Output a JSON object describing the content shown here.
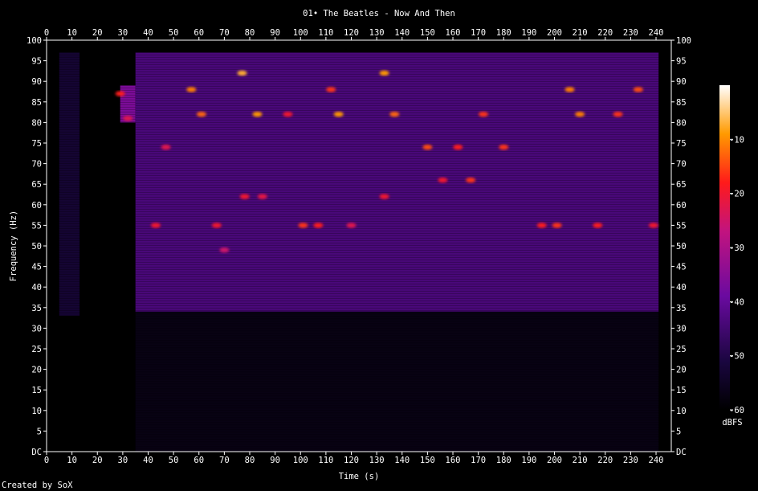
{
  "chart_data": {
    "type": "heatmap",
    "subtype": "spectrogram",
    "title": "01• The Beatles - Now And Then",
    "xlabel": "Time (s)",
    "ylabel": "Frequency (Hz)",
    "xlim": [
      0,
      246
    ],
    "ylim": [
      0,
      100
    ],
    "x_ticks": [
      0,
      10,
      20,
      30,
      40,
      50,
      60,
      70,
      80,
      90,
      100,
      110,
      120,
      130,
      140,
      150,
      160,
      170,
      180,
      190,
      200,
      210,
      220,
      230,
      240
    ],
    "y_ticks": [
      {
        "v": 0,
        "label": "DC"
      },
      {
        "v": 5,
        "label": "5"
      },
      {
        "v": 10,
        "label": "10"
      },
      {
        "v": 15,
        "label": "15"
      },
      {
        "v": 20,
        "label": "20"
      },
      {
        "v": 25,
        "label": "25"
      },
      {
        "v": 30,
        "label": "30"
      },
      {
        "v": 35,
        "label": "35"
      },
      {
        "v": 40,
        "label": "40"
      },
      {
        "v": 45,
        "label": "45"
      },
      {
        "v": 50,
        "label": "50"
      },
      {
        "v": 55,
        "label": "55"
      },
      {
        "v": 60,
        "label": "60"
      },
      {
        "v": 65,
        "label": "65"
      },
      {
        "v": 70,
        "label": "70"
      },
      {
        "v": 75,
        "label": "75"
      },
      {
        "v": 80,
        "label": "80"
      },
      {
        "v": 85,
        "label": "85"
      },
      {
        "v": 90,
        "label": "90"
      },
      {
        "v": 95,
        "label": "95"
      },
      {
        "v": 100,
        "label": "100"
      }
    ],
    "colorbar": {
      "unit": "dBFS",
      "range": [
        -60,
        0
      ],
      "ticks": [
        -10,
        -20,
        -30,
        -40,
        -50,
        -60
      ]
    },
    "bands": [
      {
        "t0": 5,
        "t1": 13,
        "f0": 33,
        "f1": 97,
        "level": -52
      },
      {
        "t0": 29,
        "t1": 35,
        "f0": 80,
        "f1": 89,
        "level": -38
      },
      {
        "t0": 35,
        "t1": 241,
        "f0": 34,
        "f1": 97,
        "level": -44
      },
      {
        "t0": 35,
        "t1": 241,
        "f0": 0,
        "f1": 34,
        "level": -57
      }
    ],
    "hotspots": [
      {
        "t": 29,
        "f": 87,
        "level": -20
      },
      {
        "t": 32,
        "f": 81,
        "level": -25
      },
      {
        "t": 47,
        "f": 74,
        "level": -25
      },
      {
        "t": 43,
        "f": 55,
        "level": -22
      },
      {
        "t": 57,
        "f": 88,
        "level": -12
      },
      {
        "t": 61,
        "f": 82,
        "level": -14
      },
      {
        "t": 67,
        "f": 55,
        "level": -22
      },
      {
        "t": 70,
        "f": 49,
        "level": -28
      },
      {
        "t": 77,
        "f": 92,
        "level": -8
      },
      {
        "t": 83,
        "f": 82,
        "level": -10
      },
      {
        "t": 78,
        "f": 62,
        "level": -22
      },
      {
        "t": 85,
        "f": 62,
        "level": -24
      },
      {
        "t": 95,
        "f": 82,
        "level": -22
      },
      {
        "t": 101,
        "f": 55,
        "level": -18
      },
      {
        "t": 107,
        "f": 55,
        "level": -20
      },
      {
        "t": 112,
        "f": 88,
        "level": -18
      },
      {
        "t": 115,
        "f": 82,
        "level": -10
      },
      {
        "t": 120,
        "f": 55,
        "level": -25
      },
      {
        "t": 133,
        "f": 92,
        "level": -10
      },
      {
        "t": 137,
        "f": 82,
        "level": -14
      },
      {
        "t": 133,
        "f": 62,
        "level": -22
      },
      {
        "t": 150,
        "f": 74,
        "level": -16
      },
      {
        "t": 156,
        "f": 66,
        "level": -22
      },
      {
        "t": 162,
        "f": 74,
        "level": -20
      },
      {
        "t": 167,
        "f": 66,
        "level": -18
      },
      {
        "t": 172,
        "f": 82,
        "level": -18
      },
      {
        "t": 180,
        "f": 74,
        "level": -18
      },
      {
        "t": 195,
        "f": 55,
        "level": -20
      },
      {
        "t": 201,
        "f": 55,
        "level": -18
      },
      {
        "t": 206,
        "f": 88,
        "level": -12
      },
      {
        "t": 210,
        "f": 82,
        "level": -12
      },
      {
        "t": 217,
        "f": 55,
        "level": -20
      },
      {
        "t": 225,
        "f": 82,
        "level": -18
      },
      {
        "t": 233,
        "f": 88,
        "level": -16
      },
      {
        "t": 239,
        "f": 55,
        "level": -22
      }
    ]
  },
  "footer": "Created by SoX"
}
